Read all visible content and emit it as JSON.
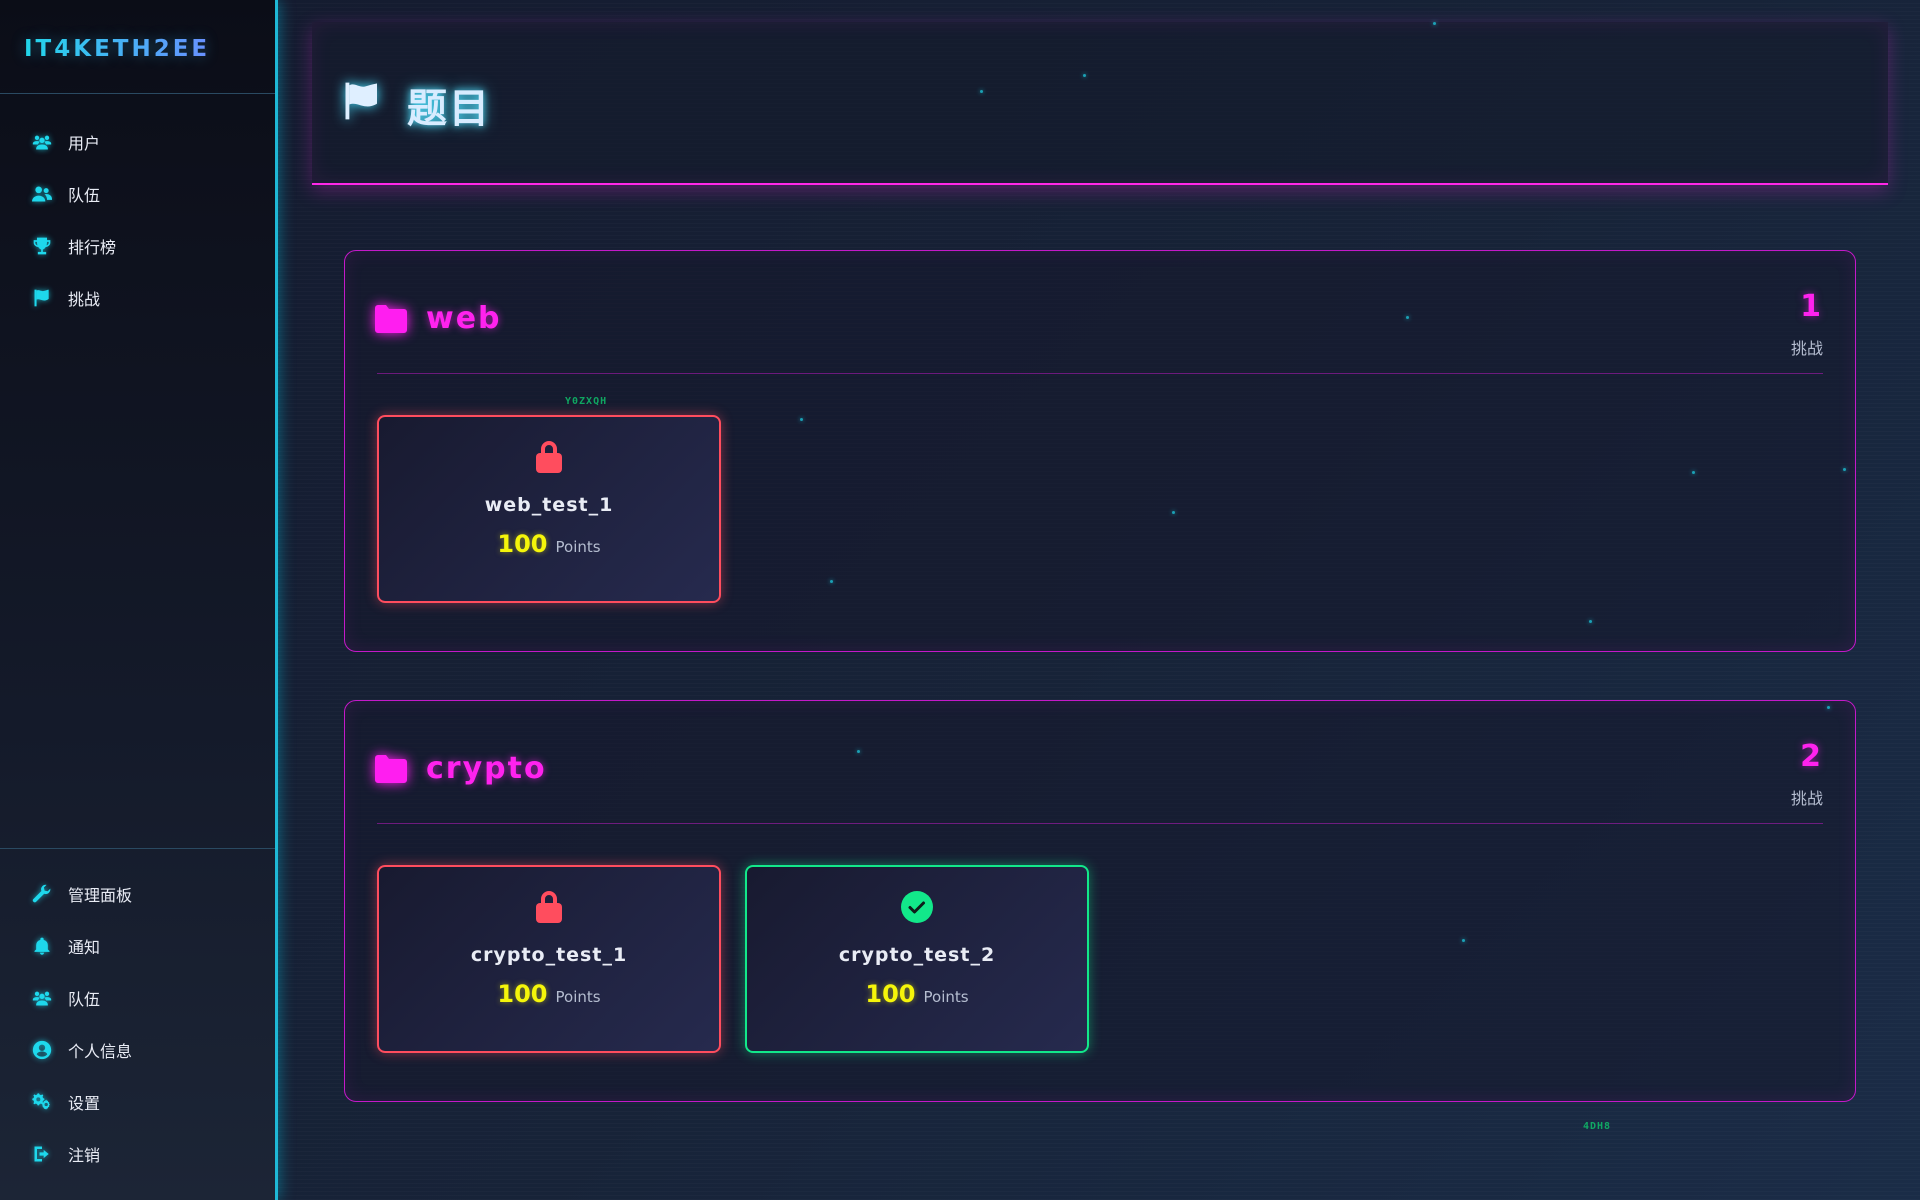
{
  "brand": {
    "name": "IT4KETH2EE"
  },
  "sidebar": {
    "top_items": [
      {
        "label": "用户",
        "icon": "users-icon"
      },
      {
        "label": "队伍",
        "icon": "team-icon"
      },
      {
        "label": "排行榜",
        "icon": "trophy-icon"
      },
      {
        "label": "挑战",
        "icon": "flag-icon"
      }
    ],
    "bottom_items": [
      {
        "label": "管理面板",
        "icon": "wrench-icon"
      },
      {
        "label": "通知",
        "icon": "bell-icon"
      },
      {
        "label": "队伍",
        "icon": "team-icon"
      },
      {
        "label": "个人信息",
        "icon": "user-circle-icon"
      },
      {
        "label": "设置",
        "icon": "gears-icon"
      },
      {
        "label": "注销",
        "icon": "sign-out-icon"
      }
    ]
  },
  "header": {
    "title": "题目",
    "icon": "flag-icon"
  },
  "categories": [
    {
      "name": "web",
      "count": "1",
      "count_label": "挑战",
      "challenges": [
        {
          "name": "web_test_1",
          "points": "100",
          "points_label": "Points",
          "status": "locked"
        }
      ]
    },
    {
      "name": "crypto",
      "count": "2",
      "count_label": "挑战",
      "challenges": [
        {
          "name": "crypto_test_1",
          "points": "100",
          "points_label": "Points",
          "status": "locked"
        },
        {
          "name": "crypto_test_2",
          "points": "100",
          "points_label": "Points",
          "status": "solved"
        }
      ]
    }
  ],
  "glitch_text": [
    "Y0ZXQH",
    "4DH8"
  ],
  "colors": {
    "accent_cyan": "#1ed8ec",
    "accent_magenta": "#ff22ee",
    "locked_red": "#ff4d5e",
    "solved_green": "#12e88a",
    "points_yellow": "#f5f50a"
  }
}
